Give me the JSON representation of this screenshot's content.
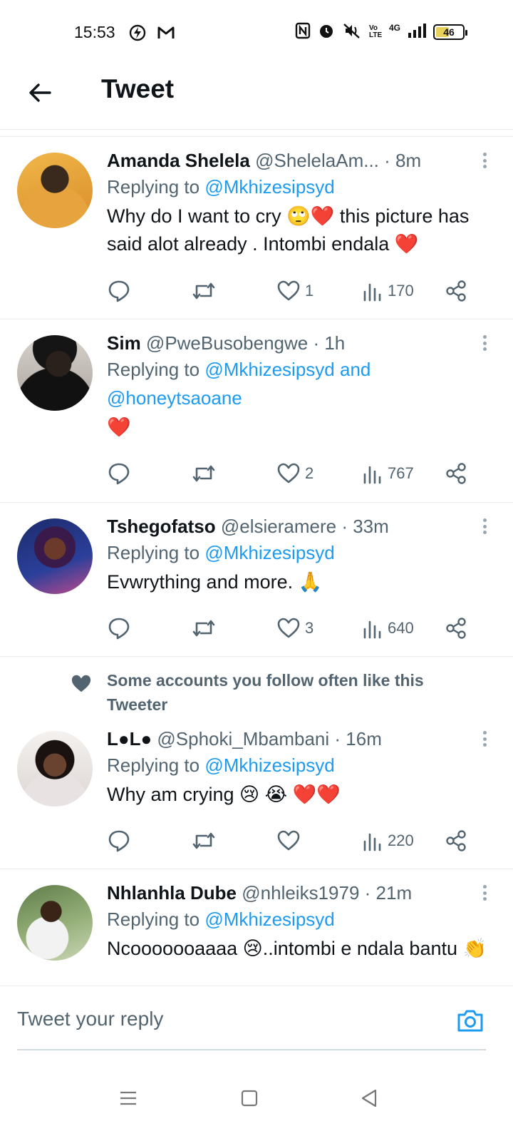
{
  "status_bar": {
    "time": "15:53",
    "network": "4G",
    "volte": "Vo LTE",
    "battery": "46",
    "battery_level": 0.46
  },
  "header": {
    "title": "Tweet"
  },
  "tweets": [
    {
      "name": "Amanda Shelela",
      "handle": "@ShelelaAm...",
      "time": "· 8m",
      "replying_prefix": "Replying to",
      "replying_to": "@Mkhizesipsyd",
      "replying_extra": "",
      "text": "Why do I want to cry 🙄❤️ this picture has said alot already . Intombi endala ❤️",
      "likes": "1",
      "views": "170"
    },
    {
      "name": "Sim",
      "handle": "@PweBusobengwe",
      "time": "· 1h",
      "replying_prefix": "Replying to",
      "replying_to": "@Mkhizesipsyd and @honeytsaoane",
      "replying_extra": "",
      "text": "❤️",
      "likes": "2",
      "views": "767"
    },
    {
      "name": "Tshegofatso",
      "handle": "@elsieramere",
      "time": "· 33m",
      "replying_prefix": "Replying to",
      "replying_to": "@Mkhizesipsyd",
      "replying_extra": "",
      "text": "Evwrything and more. 🙏",
      "likes": "3",
      "views": "640"
    },
    {
      "name": "L●L●",
      "handle": "@Sphoki_Mbambani",
      "time": "· 16m",
      "replying_prefix": "Replying to",
      "replying_to": "@Mkhizesipsyd",
      "replying_extra": "",
      "text": "Why am crying 😢 😭 ❤️❤️",
      "likes": "",
      "views": "220"
    },
    {
      "name": "Nhlanhla Dube",
      "handle": "@nhleiks1979",
      "time": "· 21m",
      "replying_prefix": "Replying to",
      "replying_to": "@Mkhizesipsyd",
      "replying_extra": "",
      "text": "Ncooooooaaaa 😢..intombi e ndala bantu 👏",
      "likes": "",
      "views": ""
    }
  ],
  "social_context": {
    "text": "Some accounts you follow often like this Tweeter"
  },
  "reply_bar": {
    "placeholder": "Tweet your reply"
  },
  "icons": {
    "back": "arrow-left-icon",
    "more": "more-vertical-icon",
    "reply": "comment-icon",
    "retweet": "retweet-icon",
    "like": "heart-icon",
    "views": "bar-chart-icon",
    "share": "share-icon",
    "camera": "camera-icon"
  },
  "colors": {
    "accent": "#1d9bf0",
    "text_primary": "#0f1419",
    "text_secondary": "#536471"
  }
}
